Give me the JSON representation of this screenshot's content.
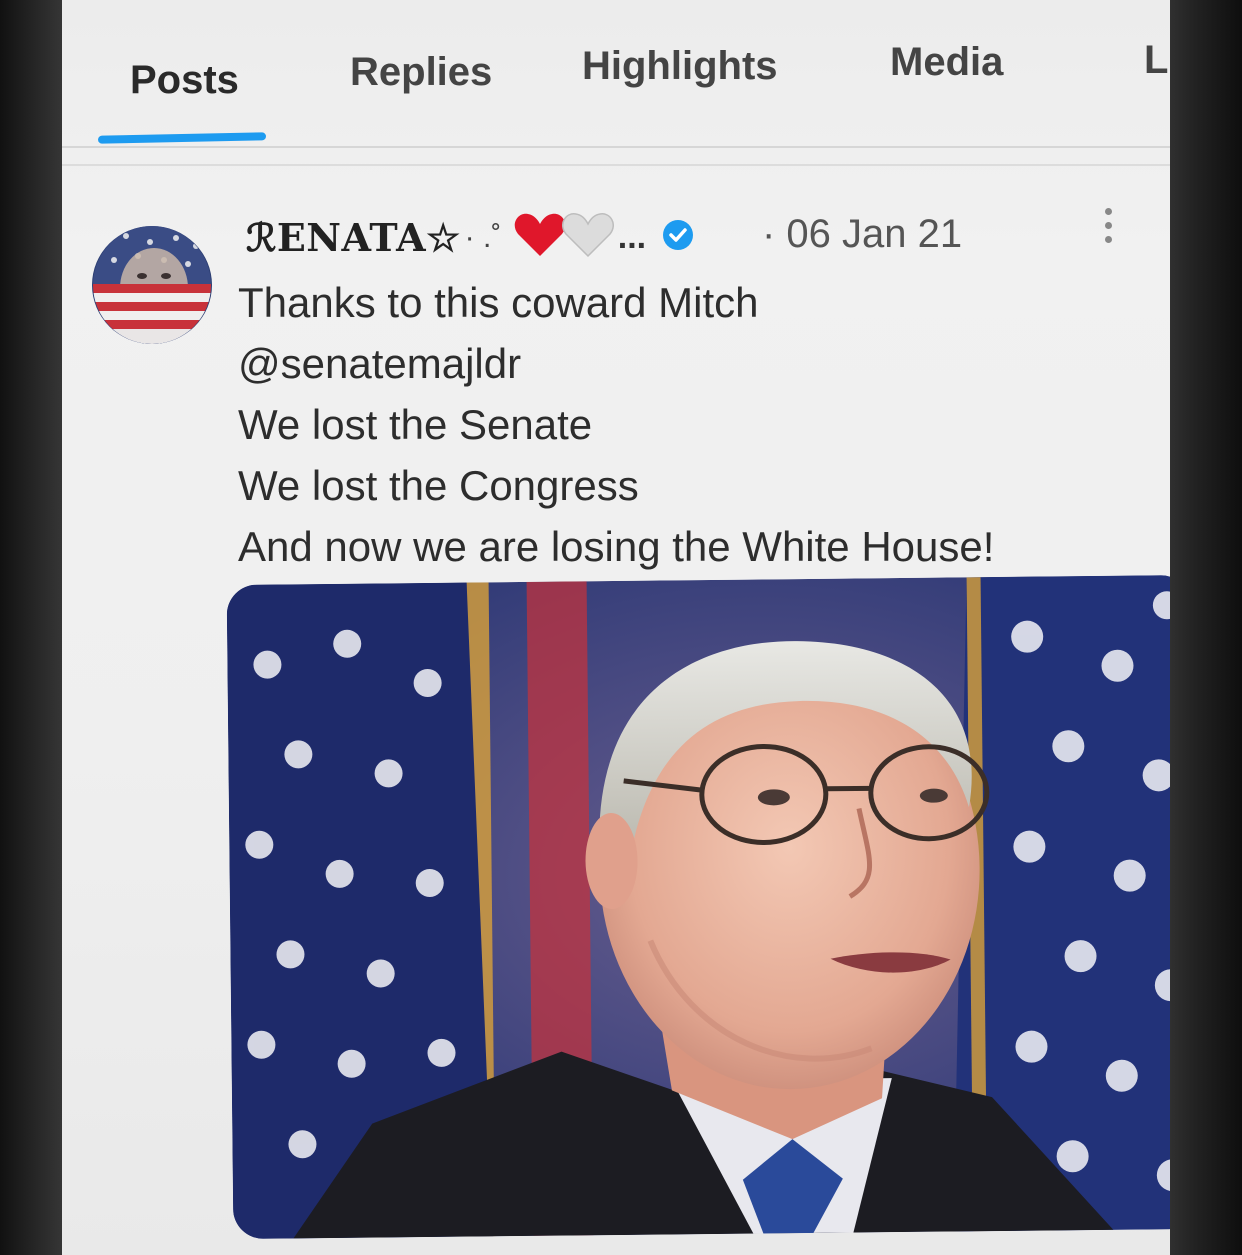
{
  "tabs": [
    {
      "label": "Posts",
      "active": true
    },
    {
      "label": "Replies",
      "active": false
    },
    {
      "label": "Highlights",
      "active": false
    },
    {
      "label": "Media",
      "active": false
    },
    {
      "label": "L",
      "active": false
    }
  ],
  "post": {
    "display_name": "ℛENATA☆",
    "name_decoration": "· .˚",
    "name_suffix": "...",
    "verified": true,
    "timestamp": "· 06 Jan 21",
    "lines": [
      "Thanks to this coward Mitch",
      "@senatemajldr",
      "We lost the Senate",
      "We lost the Congress",
      "And now we are losing the White House!"
    ],
    "avatar_icon": "american-flag-face-avatar",
    "media_image": "man-with-glasses-in-front-of-american-flag"
  },
  "colors": {
    "accent": "#1d9bf0",
    "heart_red": "#e0172b",
    "heart_white": "#dcdcdc"
  }
}
